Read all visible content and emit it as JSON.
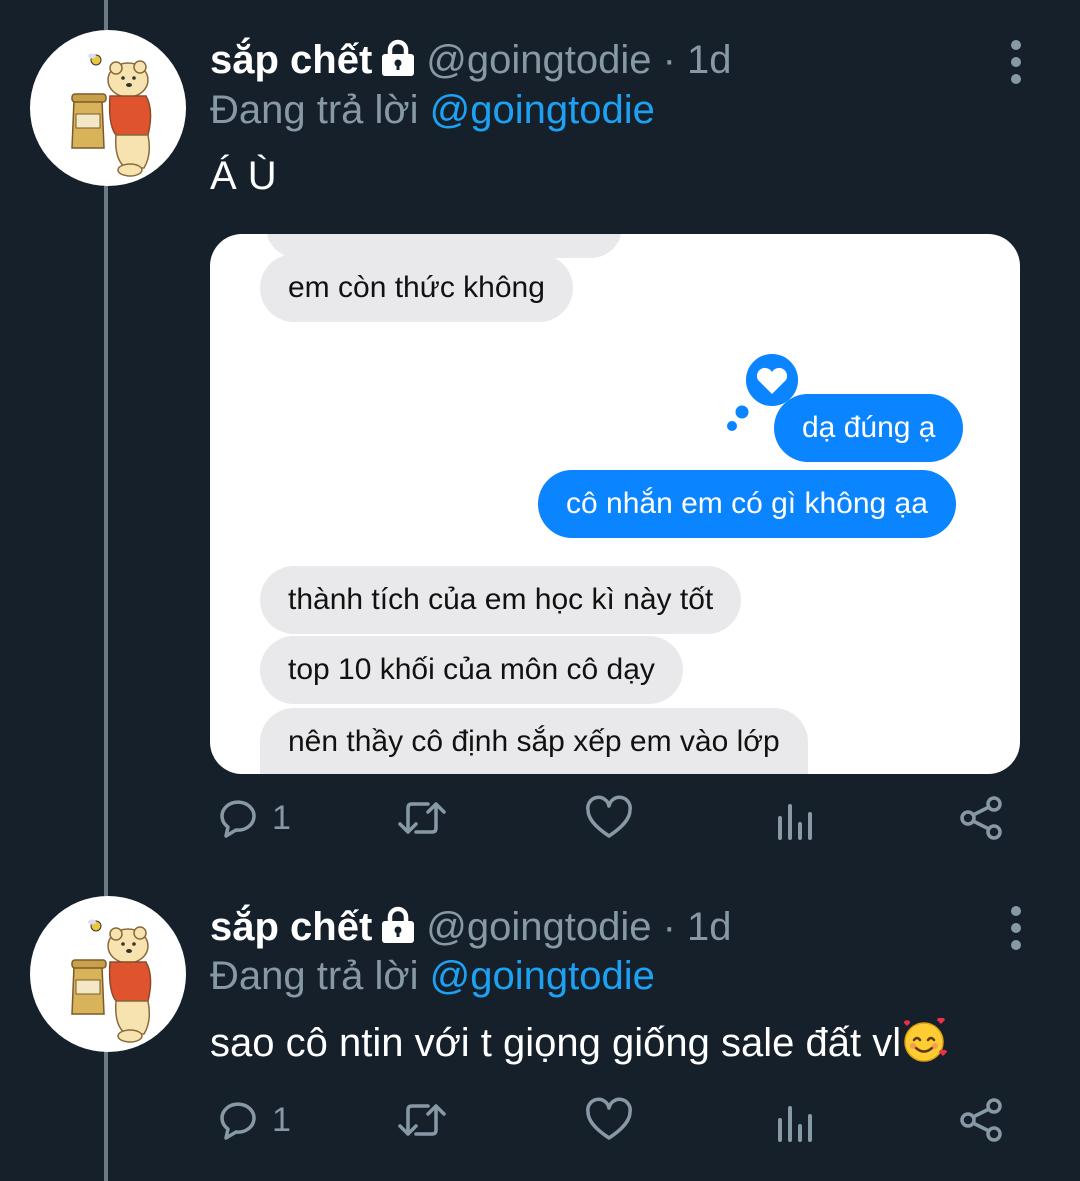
{
  "tweets": [
    {
      "name": "sắp chết",
      "handle": "@goingtodie · 1d",
      "replying_prefix": "Đang trả lời ",
      "replying_to": "@goingtodie",
      "text": "Á Ù",
      "reply_count": "1",
      "media": {
        "messages": [
          {
            "side": "left",
            "text": "em còn thức không"
          },
          {
            "side": "right",
            "text": "dạ đúng ạ",
            "reaction": "heart"
          },
          {
            "side": "right",
            "text": "cô nhắn em có gì không ạa"
          },
          {
            "side": "left",
            "text": "thành tích của em học kì này tốt"
          },
          {
            "side": "left",
            "text": "top 10 khối của môn cô dạy"
          },
          {
            "side": "left",
            "text": "nên thầy cô định sắp xếp em vào lớp"
          }
        ]
      }
    },
    {
      "name": "sắp chết",
      "handle": "@goingtodie · 1d",
      "replying_prefix": "Đang trả lời ",
      "replying_to": "@goingtodie",
      "text": "sao cô ntin với t giọng giống sale đất vl",
      "emoji": "smiling-face-with-hearts",
      "reply_count": "1"
    }
  ],
  "colors": {
    "background": "#15202b",
    "secondary_text": "#8899a6",
    "link": "#1da1f2",
    "imessage_blue": "#0a84ff",
    "imessage_gray": "#e9e9eb"
  }
}
